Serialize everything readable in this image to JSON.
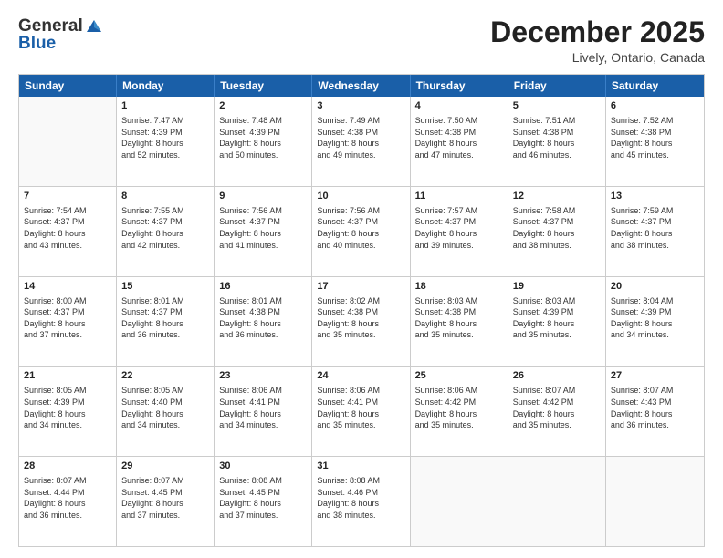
{
  "header": {
    "logo_general": "General",
    "logo_blue": "Blue",
    "month_title": "December 2025",
    "location": "Lively, Ontario, Canada"
  },
  "weekdays": [
    "Sunday",
    "Monday",
    "Tuesday",
    "Wednesday",
    "Thursday",
    "Friday",
    "Saturday"
  ],
  "rows": [
    [
      {
        "day": "",
        "info": ""
      },
      {
        "day": "1",
        "info": "Sunrise: 7:47 AM\nSunset: 4:39 PM\nDaylight: 8 hours\nand 52 minutes."
      },
      {
        "day": "2",
        "info": "Sunrise: 7:48 AM\nSunset: 4:39 PM\nDaylight: 8 hours\nand 50 minutes."
      },
      {
        "day": "3",
        "info": "Sunrise: 7:49 AM\nSunset: 4:38 PM\nDaylight: 8 hours\nand 49 minutes."
      },
      {
        "day": "4",
        "info": "Sunrise: 7:50 AM\nSunset: 4:38 PM\nDaylight: 8 hours\nand 47 minutes."
      },
      {
        "day": "5",
        "info": "Sunrise: 7:51 AM\nSunset: 4:38 PM\nDaylight: 8 hours\nand 46 minutes."
      },
      {
        "day": "6",
        "info": "Sunrise: 7:52 AM\nSunset: 4:38 PM\nDaylight: 8 hours\nand 45 minutes."
      }
    ],
    [
      {
        "day": "7",
        "info": "Sunrise: 7:54 AM\nSunset: 4:37 PM\nDaylight: 8 hours\nand 43 minutes."
      },
      {
        "day": "8",
        "info": "Sunrise: 7:55 AM\nSunset: 4:37 PM\nDaylight: 8 hours\nand 42 minutes."
      },
      {
        "day": "9",
        "info": "Sunrise: 7:56 AM\nSunset: 4:37 PM\nDaylight: 8 hours\nand 41 minutes."
      },
      {
        "day": "10",
        "info": "Sunrise: 7:56 AM\nSunset: 4:37 PM\nDaylight: 8 hours\nand 40 minutes."
      },
      {
        "day": "11",
        "info": "Sunrise: 7:57 AM\nSunset: 4:37 PM\nDaylight: 8 hours\nand 39 minutes."
      },
      {
        "day": "12",
        "info": "Sunrise: 7:58 AM\nSunset: 4:37 PM\nDaylight: 8 hours\nand 38 minutes."
      },
      {
        "day": "13",
        "info": "Sunrise: 7:59 AM\nSunset: 4:37 PM\nDaylight: 8 hours\nand 38 minutes."
      }
    ],
    [
      {
        "day": "14",
        "info": "Sunrise: 8:00 AM\nSunset: 4:37 PM\nDaylight: 8 hours\nand 37 minutes."
      },
      {
        "day": "15",
        "info": "Sunrise: 8:01 AM\nSunset: 4:37 PM\nDaylight: 8 hours\nand 36 minutes."
      },
      {
        "day": "16",
        "info": "Sunrise: 8:01 AM\nSunset: 4:38 PM\nDaylight: 8 hours\nand 36 minutes."
      },
      {
        "day": "17",
        "info": "Sunrise: 8:02 AM\nSunset: 4:38 PM\nDaylight: 8 hours\nand 35 minutes."
      },
      {
        "day": "18",
        "info": "Sunrise: 8:03 AM\nSunset: 4:38 PM\nDaylight: 8 hours\nand 35 minutes."
      },
      {
        "day": "19",
        "info": "Sunrise: 8:03 AM\nSunset: 4:39 PM\nDaylight: 8 hours\nand 35 minutes."
      },
      {
        "day": "20",
        "info": "Sunrise: 8:04 AM\nSunset: 4:39 PM\nDaylight: 8 hours\nand 34 minutes."
      }
    ],
    [
      {
        "day": "21",
        "info": "Sunrise: 8:05 AM\nSunset: 4:39 PM\nDaylight: 8 hours\nand 34 minutes."
      },
      {
        "day": "22",
        "info": "Sunrise: 8:05 AM\nSunset: 4:40 PM\nDaylight: 8 hours\nand 34 minutes."
      },
      {
        "day": "23",
        "info": "Sunrise: 8:06 AM\nSunset: 4:41 PM\nDaylight: 8 hours\nand 34 minutes."
      },
      {
        "day": "24",
        "info": "Sunrise: 8:06 AM\nSunset: 4:41 PM\nDaylight: 8 hours\nand 35 minutes."
      },
      {
        "day": "25",
        "info": "Sunrise: 8:06 AM\nSunset: 4:42 PM\nDaylight: 8 hours\nand 35 minutes."
      },
      {
        "day": "26",
        "info": "Sunrise: 8:07 AM\nSunset: 4:42 PM\nDaylight: 8 hours\nand 35 minutes."
      },
      {
        "day": "27",
        "info": "Sunrise: 8:07 AM\nSunset: 4:43 PM\nDaylight: 8 hours\nand 36 minutes."
      }
    ],
    [
      {
        "day": "28",
        "info": "Sunrise: 8:07 AM\nSunset: 4:44 PM\nDaylight: 8 hours\nand 36 minutes."
      },
      {
        "day": "29",
        "info": "Sunrise: 8:07 AM\nSunset: 4:45 PM\nDaylight: 8 hours\nand 37 minutes."
      },
      {
        "day": "30",
        "info": "Sunrise: 8:08 AM\nSunset: 4:45 PM\nDaylight: 8 hours\nand 37 minutes."
      },
      {
        "day": "31",
        "info": "Sunrise: 8:08 AM\nSunset: 4:46 PM\nDaylight: 8 hours\nand 38 minutes."
      },
      {
        "day": "",
        "info": ""
      },
      {
        "day": "",
        "info": ""
      },
      {
        "day": "",
        "info": ""
      }
    ]
  ]
}
